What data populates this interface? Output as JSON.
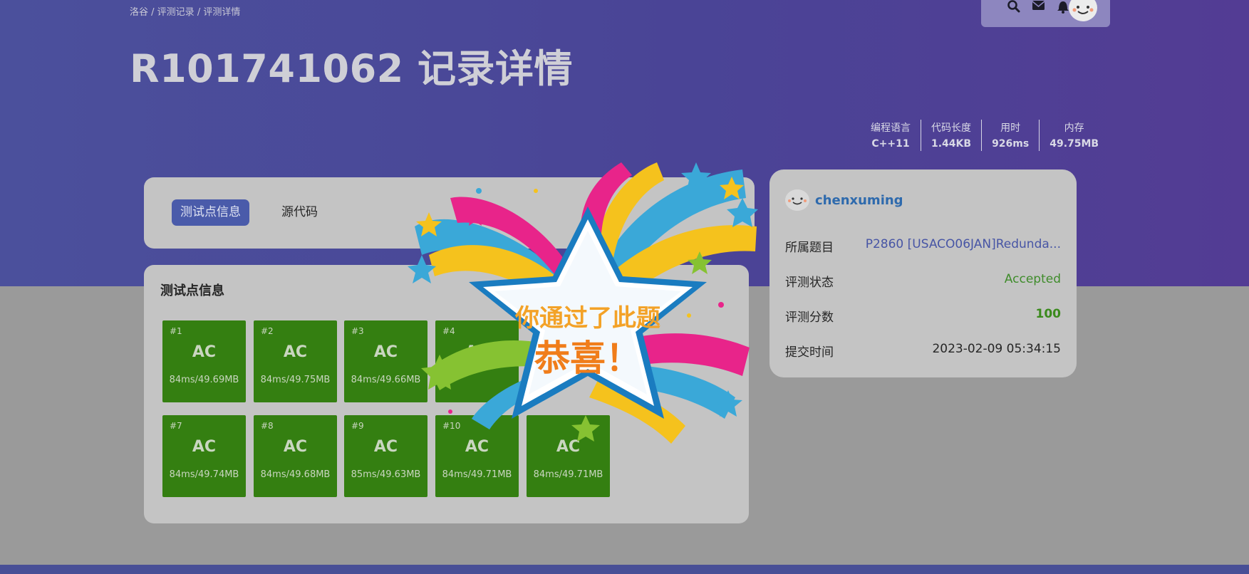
{
  "breadcrumb": [
    "洛谷",
    "评测记录",
    "评测详情"
  ],
  "breadcrumb_sep": " / ",
  "title": "R101741062 记录详情",
  "topnav": {
    "icons": [
      "search-icon",
      "mail-icon",
      "bell-icon"
    ]
  },
  "stats": [
    {
      "label": "编程语言",
      "value": "C++11"
    },
    {
      "label": "代码长度",
      "value": "1.44KB"
    },
    {
      "label": "用时",
      "value": "926ms"
    },
    {
      "label": "内存",
      "value": "49.75MB"
    }
  ],
  "tabs": [
    {
      "label": "测试点信息",
      "active": true
    },
    {
      "label": "源代码",
      "active": false
    }
  ],
  "tests_title": "测试点信息",
  "tests": [
    {
      "id": "#1",
      "status": "AC",
      "metric": "84ms/49.69MB"
    },
    {
      "id": "#2",
      "status": "AC",
      "metric": "84ms/49.75MB"
    },
    {
      "id": "#3",
      "status": "AC",
      "metric": "84ms/49.66MB"
    },
    {
      "id": "#4",
      "status": "AC",
      "metric": ""
    },
    {
      "id": "#7",
      "status": "AC",
      "metric": "84ms/49.74MB"
    },
    {
      "id": "#8",
      "status": "AC",
      "metric": "84ms/49.68MB"
    },
    {
      "id": "#9",
      "status": "AC",
      "metric": "85ms/49.63MB"
    },
    {
      "id": "#10",
      "status": "AC",
      "metric": "84ms/49.71MB"
    },
    {
      "id": "",
      "status": "AC",
      "metric": "84ms/49.71MB"
    }
  ],
  "info": {
    "user": "chenxuming",
    "rows": [
      {
        "label": "所属题目",
        "value": "P2860 [USACO06JAN]Redunda..."
      },
      {
        "label": "评测状态",
        "value": "Accepted"
      },
      {
        "label": "评测分数",
        "value": "100"
      },
      {
        "label": "提交时间",
        "value": "2023-02-09 05:34:15"
      }
    ]
  },
  "celebration": {
    "line1": "你通过了此题",
    "line2": "恭喜！"
  },
  "colors": {
    "header": "#4a4496",
    "ac_tile": "#347f11",
    "accepted": "#3f8c2b",
    "active_tab": "#4a5baa"
  }
}
